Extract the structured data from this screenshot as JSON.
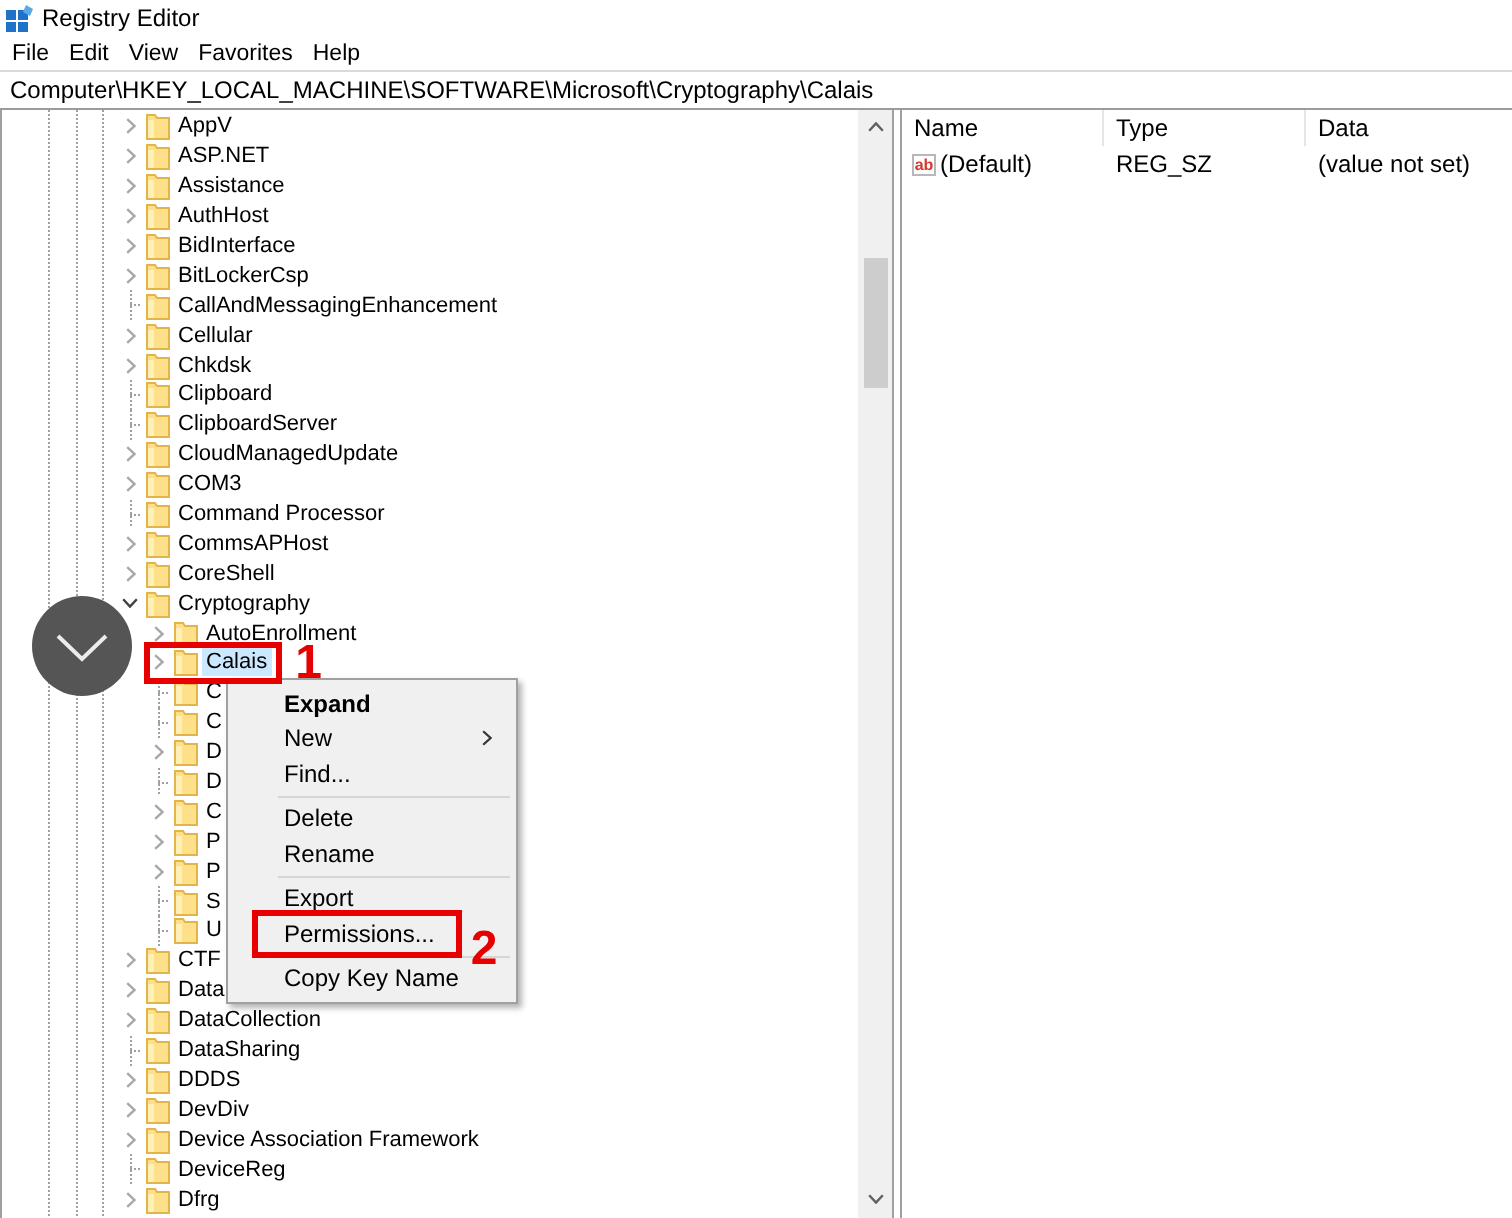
{
  "window": {
    "title": "Registry Editor"
  },
  "menu_bar": [
    "File",
    "Edit",
    "View",
    "Favorites",
    "Help"
  ],
  "address_bar": {
    "value": "Computer\\HKEY_LOCAL_MACHINE\\SOFTWARE\\Microsoft\\Cryptography\\Calais"
  },
  "tree": {
    "items": [
      {
        "label": "AppV",
        "expandable": true,
        "expanded": false,
        "selected": false
      },
      {
        "label": "ASP.NET",
        "expandable": true,
        "expanded": false,
        "selected": false
      },
      {
        "label": "Assistance",
        "expandable": true,
        "expanded": false,
        "selected": false
      },
      {
        "label": "AuthHost",
        "expandable": true,
        "expanded": false,
        "selected": false
      },
      {
        "label": "BidInterface",
        "expandable": true,
        "expanded": false,
        "selected": false
      },
      {
        "label": "BitLockerCsp",
        "expandable": true,
        "expanded": false,
        "selected": false
      },
      {
        "label": "CallAndMessagingEnhancement",
        "expandable": false,
        "expanded": false,
        "selected": false
      },
      {
        "label": "Cellular",
        "expandable": true,
        "expanded": false,
        "selected": false
      },
      {
        "label": "Chkdsk",
        "expandable": true,
        "expanded": false,
        "selected": false
      },
      {
        "label": "Clipboard",
        "expandable": false,
        "expanded": false,
        "selected": false
      },
      {
        "label": "ClipboardServer",
        "expandable": false,
        "expanded": false,
        "selected": false
      },
      {
        "label": "CloudManagedUpdate",
        "expandable": true,
        "expanded": false,
        "selected": false
      },
      {
        "label": "COM3",
        "expandable": true,
        "expanded": false,
        "selected": false
      },
      {
        "label": "Command Processor",
        "expandable": false,
        "expanded": false,
        "selected": false
      },
      {
        "label": "CommsAPHost",
        "expandable": true,
        "expanded": false,
        "selected": false
      },
      {
        "label": "CoreShell",
        "expandable": true,
        "expanded": false,
        "selected": false
      },
      {
        "label": "Cryptography",
        "expandable": true,
        "expanded": true,
        "selected": false,
        "children": [
          {
            "label": "AutoEnrollment",
            "expandable": true,
            "expanded": false,
            "selected": false
          },
          {
            "label": "Calais",
            "expandable": true,
            "expanded": false,
            "selected": true,
            "callout": "1"
          },
          {
            "label": "C",
            "expandable": false,
            "expanded": false,
            "selected": false
          },
          {
            "label": "C",
            "expandable": false,
            "expanded": false,
            "selected": false
          },
          {
            "label": "D",
            "expandable": true,
            "expanded": false,
            "selected": false
          },
          {
            "label": "D",
            "expandable": false,
            "expanded": false,
            "selected": false
          },
          {
            "label": "C",
            "expandable": true,
            "expanded": false,
            "selected": false
          },
          {
            "label": "P",
            "expandable": true,
            "expanded": false,
            "selected": false
          },
          {
            "label": "P",
            "expandable": true,
            "expanded": false,
            "selected": false
          },
          {
            "label": "S",
            "expandable": false,
            "expanded": false,
            "selected": false
          },
          {
            "label": "U",
            "expandable": false,
            "expanded": false,
            "selected": false
          }
        ]
      },
      {
        "label": "CTF",
        "expandable": true,
        "expanded": false,
        "selected": false
      },
      {
        "label": "Data",
        "expandable": true,
        "expanded": false,
        "selected": false
      },
      {
        "label": "DataCollection",
        "expandable": true,
        "expanded": false,
        "selected": false
      },
      {
        "label": "DataSharing",
        "expandable": false,
        "expanded": false,
        "selected": false
      },
      {
        "label": "DDDS",
        "expandable": true,
        "expanded": false,
        "selected": false
      },
      {
        "label": "DevDiv",
        "expandable": true,
        "expanded": false,
        "selected": false
      },
      {
        "label": "Device Association Framework",
        "expandable": true,
        "expanded": false,
        "selected": false
      },
      {
        "label": "DeviceReg",
        "expandable": false,
        "expanded": false,
        "selected": false
      },
      {
        "label": "Dfrg",
        "expandable": true,
        "expanded": false,
        "selected": false
      }
    ]
  },
  "values_pane": {
    "columns": [
      "Name",
      "Type",
      "Data"
    ],
    "rows": [
      {
        "icon_label": "ab",
        "name": "(Default)",
        "type": "REG_SZ",
        "data": "(value not set)"
      }
    ]
  },
  "context_menu": {
    "items": [
      {
        "kind": "default",
        "label": "Expand"
      },
      {
        "kind": "submenu",
        "label": "New"
      },
      {
        "kind": "item",
        "label": "Find..."
      },
      {
        "kind": "separator"
      },
      {
        "kind": "item",
        "label": "Delete"
      },
      {
        "kind": "item",
        "label": "Rename"
      },
      {
        "kind": "separator"
      },
      {
        "kind": "item",
        "label": "Export"
      },
      {
        "kind": "item",
        "label": "Permissions...",
        "callout": "2"
      },
      {
        "kind": "separator"
      },
      {
        "kind": "item",
        "label": "Copy Key Name"
      }
    ]
  }
}
